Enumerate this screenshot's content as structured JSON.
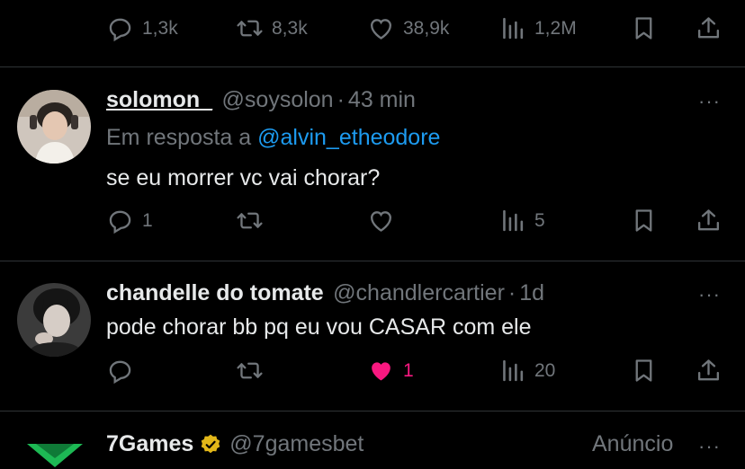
{
  "top_actions": {
    "replies": "1,3k",
    "reposts": "8,3k",
    "likes": "38,9k",
    "views": "1,2M"
  },
  "tweets": [
    {
      "name": "solomon_",
      "handle": "@soysolon",
      "sep": "·",
      "time": "43 min",
      "reply_prefix": "Em resposta a",
      "reply_to": "@alvin_etheodore",
      "text": "se eu morrer vc vai chorar?",
      "replies": "1",
      "reposts": "",
      "likes": "",
      "views": "5"
    },
    {
      "name": "chandelle do tomate",
      "handle": "@chandlercartier",
      "sep": "·",
      "time": "1d",
      "text": "pode chorar bb pq eu vou CASAR com ele",
      "replies": "",
      "reposts": "",
      "likes": "1",
      "liked": true,
      "views": "20"
    }
  ],
  "ad": {
    "name": "7Games",
    "handle": "@7gamesbet",
    "label": "Anúncio"
  },
  "more_glyph": "···",
  "colors": {
    "background": "#000000",
    "text": "#e7e9ea",
    "muted": "#71767b",
    "link": "#1d9bf0",
    "like_active": "#f91880",
    "verified": "#e2b719"
  }
}
